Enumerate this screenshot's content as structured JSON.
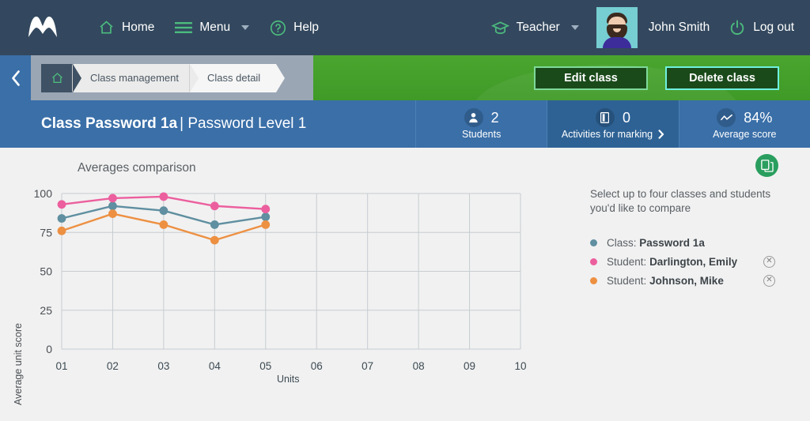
{
  "topnav": {
    "logo_name": "app-logo",
    "items": [
      {
        "label": "Home",
        "icon": "home-icon"
      },
      {
        "label": "Menu",
        "icon": "hamburger-icon"
      },
      {
        "label": "Help",
        "icon": "question-circle-icon"
      }
    ],
    "role": {
      "label": "Teacher",
      "icon": "graduation-cap-icon"
    },
    "username": "John Smith",
    "logout": {
      "label": "Log out",
      "icon": "power-icon"
    }
  },
  "breadcrumb": {
    "back_icon": "chevron-left-icon",
    "home_icon": "home-icon",
    "items": [
      "Class management",
      "Class detail"
    ]
  },
  "actions": {
    "edit_label": "Edit class",
    "delete_label": "Delete class"
  },
  "title": {
    "bold": "Class Password 1a",
    "rest": "| Password Level 1"
  },
  "stats": [
    {
      "icon": "person-icon",
      "value": "2",
      "label": "Students",
      "chevron": false
    },
    {
      "icon": "book-icon",
      "value": "0",
      "label": "Activities for marking",
      "chevron": true
    },
    {
      "icon": "trendline-icon",
      "value": "84%",
      "label": "Average score",
      "chevron": false
    }
  ],
  "panel": {
    "chart_title": "Averages comparison",
    "export_icon": "documents-icon",
    "note": "Select up to four classes and students you'd like to compare",
    "legend": [
      {
        "prefix": "Class:",
        "name": "Password 1a",
        "color": "#5f8fa0",
        "removable": false
      },
      {
        "prefix": "Student:",
        "name": "Darlington, Emily",
        "color": "#ec5f9e",
        "removable": true
      },
      {
        "prefix": "Student:",
        "name": "Johnson, Mike",
        "color": "#ed9042",
        "removable": true
      }
    ],
    "remove_icon": "close-circle-icon"
  },
  "chart_data": {
    "type": "line",
    "title": "Averages comparison",
    "xlabel": "Units",
    "ylabel": "Average unit score",
    "categories": [
      "01",
      "02",
      "03",
      "04",
      "05",
      "06",
      "07",
      "08",
      "09",
      "10"
    ],
    "x_tick_labels": [
      "01",
      "02",
      "03",
      "04",
      "05",
      "06",
      "07",
      "08",
      "09",
      "10"
    ],
    "y_tick_labels": [
      "0",
      "25",
      "50",
      "75",
      "100"
    ],
    "ylim": [
      0,
      100
    ],
    "grid": true,
    "legend_position": "right",
    "series": [
      {
        "name": "Class: Password 1a",
        "color": "#5f8fa0",
        "x": [
          "01",
          "02",
          "03",
          "04",
          "05"
        ],
        "values": [
          84,
          92,
          89,
          80,
          85
        ]
      },
      {
        "name": "Student: Darlington, Emily",
        "color": "#ec5f9e",
        "x": [
          "01",
          "02",
          "03",
          "04",
          "05"
        ],
        "values": [
          93,
          97,
          98,
          92,
          90
        ]
      },
      {
        "name": "Student: Johnson, Mike",
        "color": "#ed9042",
        "x": [
          "01",
          "02",
          "03",
          "04",
          "05"
        ],
        "values": [
          76,
          87,
          80,
          70,
          80
        ]
      }
    ]
  }
}
